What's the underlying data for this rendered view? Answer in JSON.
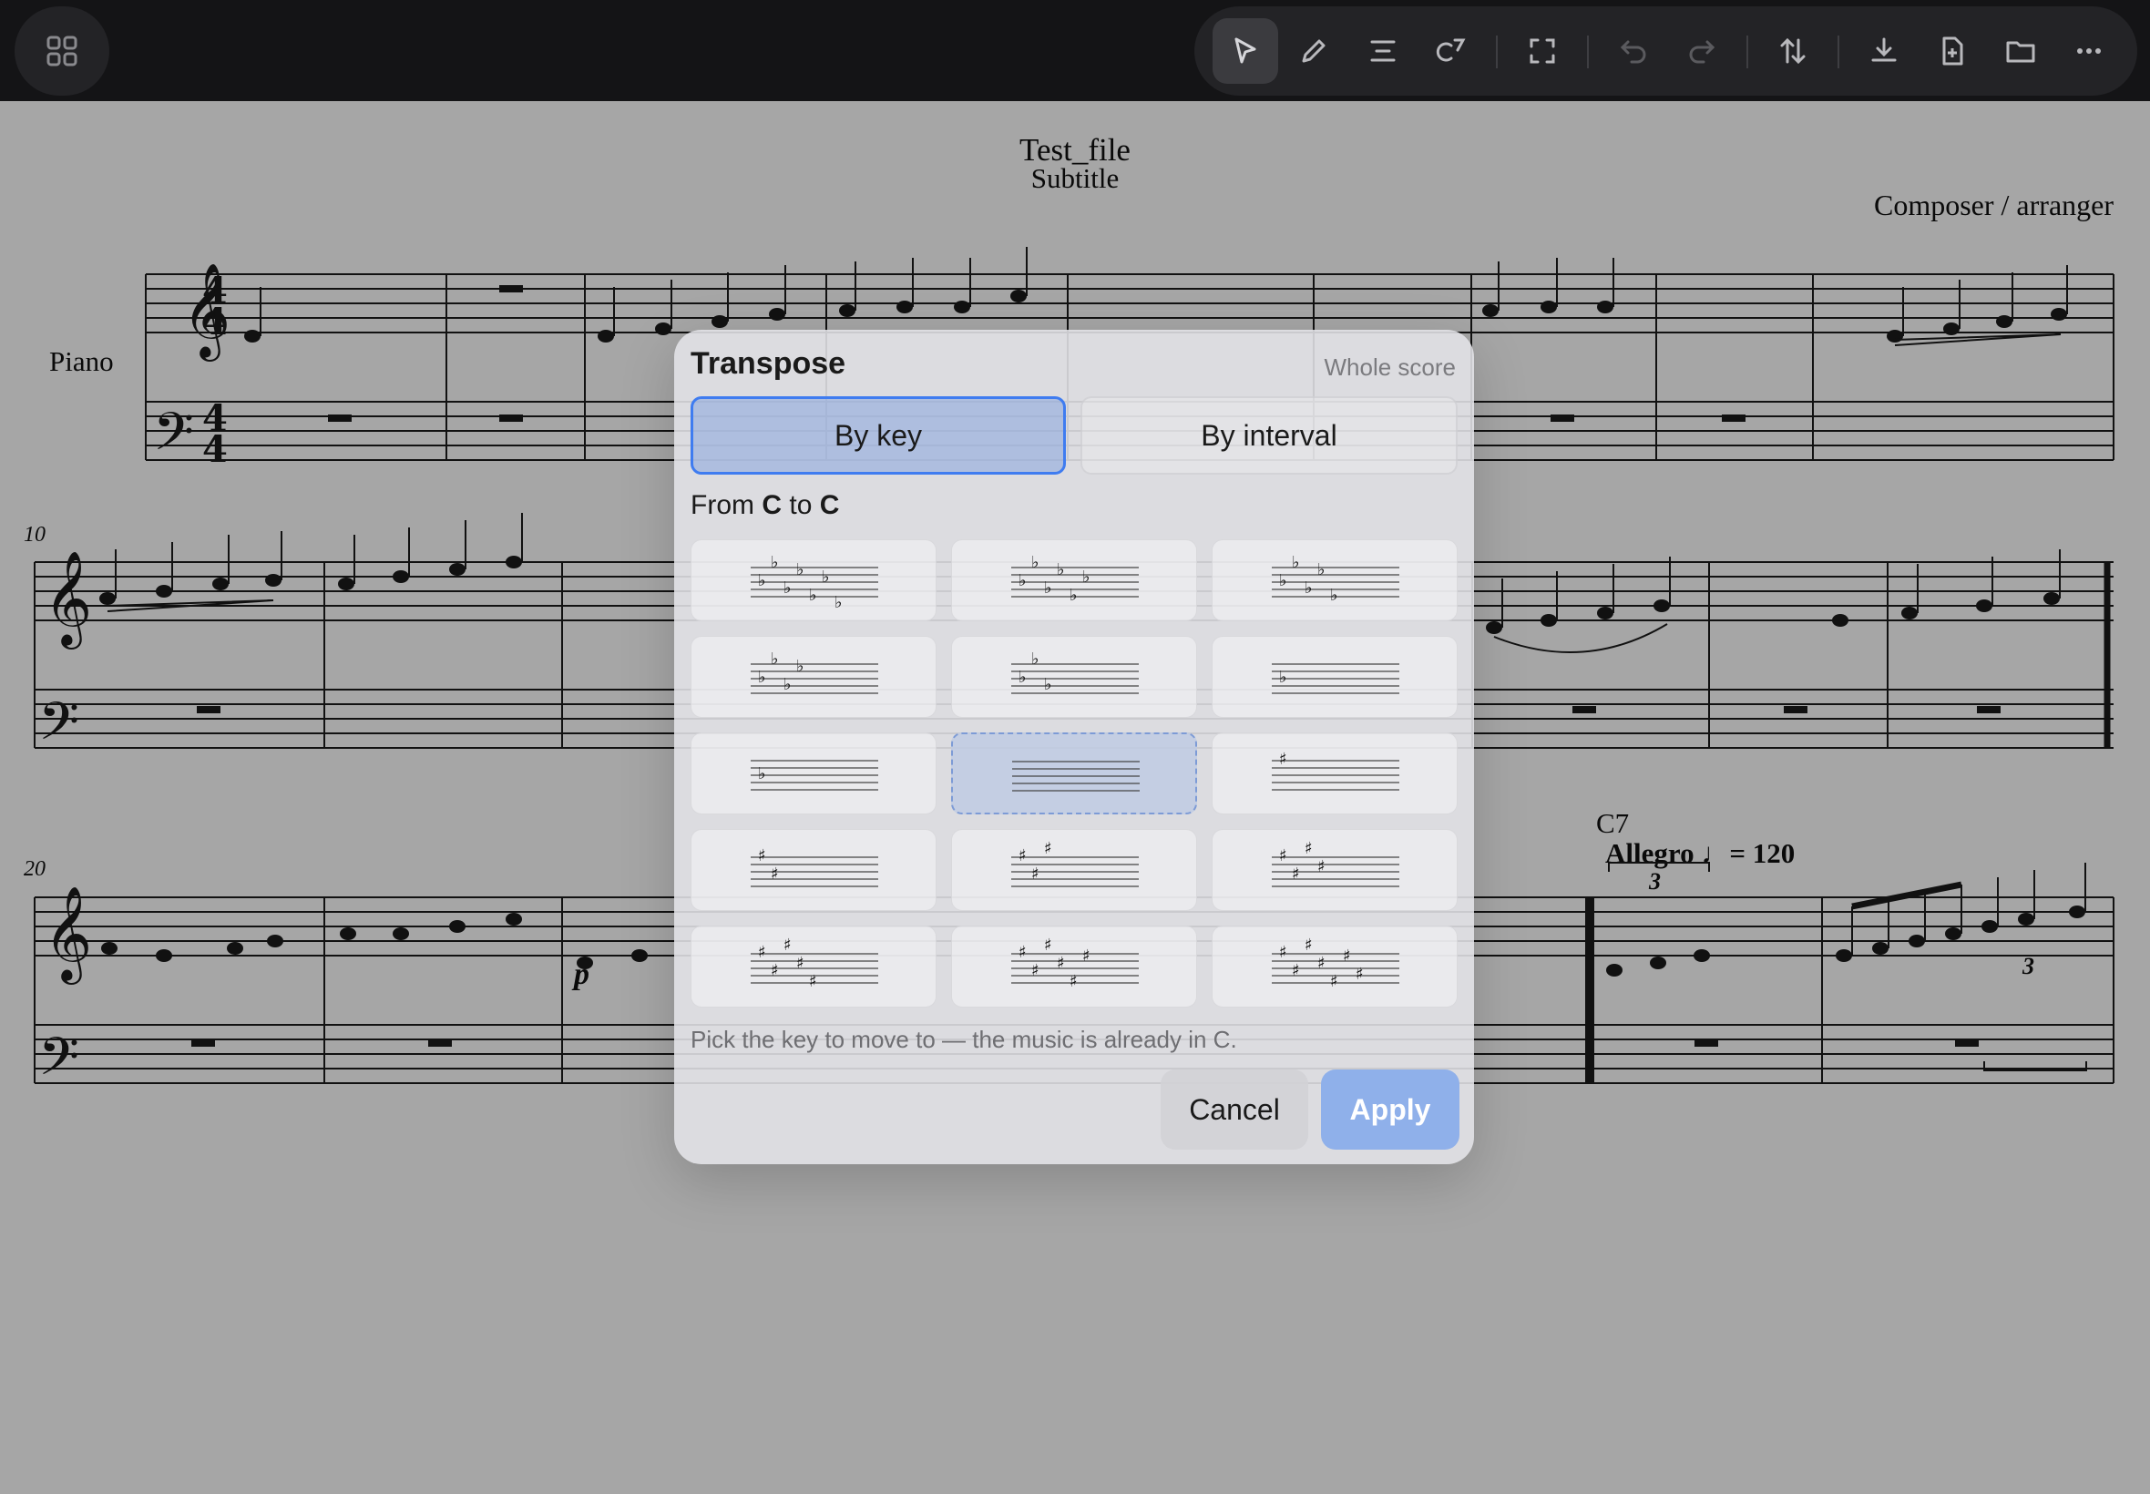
{
  "toolbar": {
    "apps_icon": "grid-icon",
    "buttons": [
      {
        "name": "select-tool",
        "icon": "cursor-icon",
        "active": true
      },
      {
        "name": "pencil-tool",
        "icon": "pencil-icon"
      },
      {
        "name": "align-tool",
        "icon": "align-center-icon"
      },
      {
        "name": "chord-tool",
        "icon": "chord-c7-icon",
        "label": "C⁷"
      },
      {
        "name": "fullscreen-tool",
        "icon": "expand-icon"
      },
      {
        "name": "undo",
        "icon": "undo-icon",
        "disabled": true
      },
      {
        "name": "redo",
        "icon": "redo-icon",
        "disabled": true
      },
      {
        "name": "transpose",
        "icon": "transpose-arrows-icon"
      },
      {
        "name": "download",
        "icon": "download-icon"
      },
      {
        "name": "new-file",
        "icon": "new-file-icon"
      },
      {
        "name": "open-folder",
        "icon": "folder-icon"
      },
      {
        "name": "more",
        "icon": "more-icon"
      }
    ]
  },
  "score": {
    "title": "Test_file",
    "subtitle": "Subtitle",
    "composer": "Composer / arranger",
    "instrument": "Piano",
    "measure_numbers": [
      "10",
      "20"
    ],
    "chord_symbol": "C7",
    "tempo_text": "Allegro",
    "tempo_value": "= 120",
    "tuplet": "3",
    "dynamic": "p"
  },
  "dialog": {
    "title": "Transpose",
    "scope": "Whole score",
    "tabs": {
      "by_key": "By key",
      "by_interval": "By interval"
    },
    "from_prefix": "From",
    "from_key": "C",
    "to_word": "to",
    "to_key": "C",
    "hint": "Pick the key to move to — the music is already in C.",
    "cancel_label": "Cancel",
    "apply_label": "Apply",
    "accent_color": "#3f7cf0"
  },
  "key_signatures": [
    {
      "accidental": "flat",
      "count": 7
    },
    {
      "accidental": "flat",
      "count": 6
    },
    {
      "accidental": "flat",
      "count": 5
    },
    {
      "accidental": "flat",
      "count": 4
    },
    {
      "accidental": "flat",
      "count": 3
    },
    {
      "accidental": "flat",
      "count": 1
    },
    {
      "accidental": "flat",
      "count": 1
    },
    {
      "accidental": "none",
      "count": 0,
      "selected": true
    },
    {
      "accidental": "sharp",
      "count": 1
    },
    {
      "accidental": "sharp",
      "count": 2
    },
    {
      "accidental": "sharp",
      "count": 3
    },
    {
      "accidental": "sharp",
      "count": 4
    },
    {
      "accidental": "sharp",
      "count": 5
    },
    {
      "accidental": "sharp",
      "count": 6
    },
    {
      "accidental": "sharp",
      "count": 7
    }
  ]
}
